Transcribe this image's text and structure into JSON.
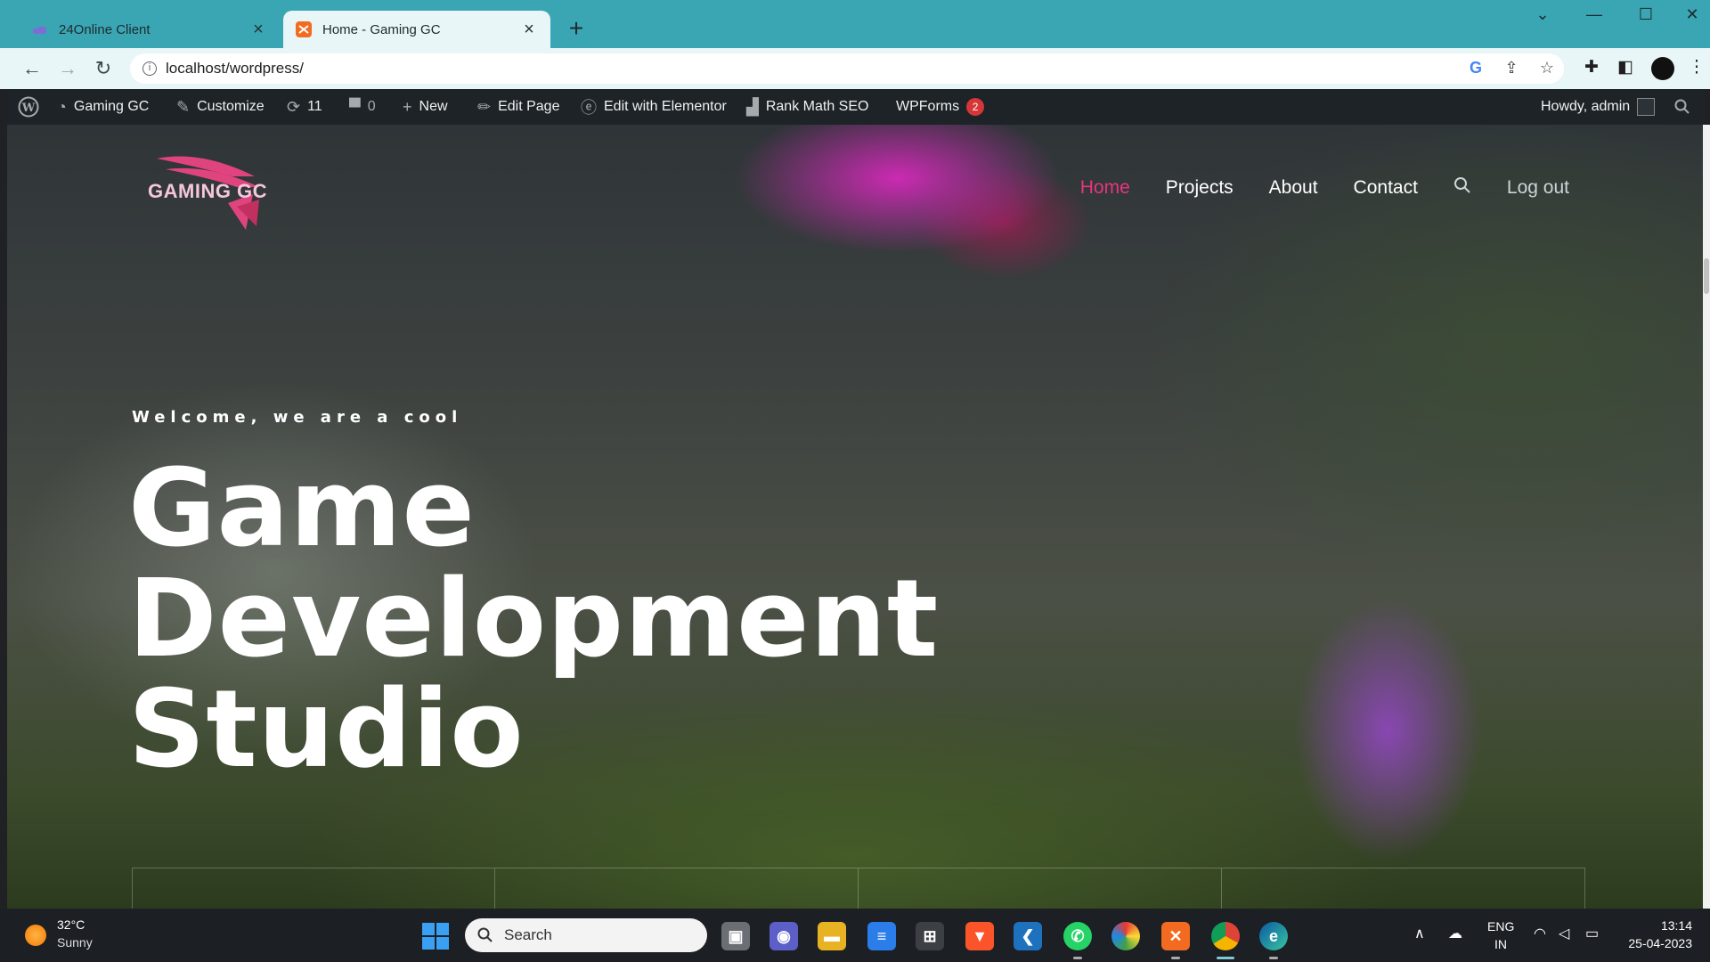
{
  "browser": {
    "tabs": [
      {
        "title": "24Online Client",
        "icon": "cloud-icon"
      },
      {
        "title": "Home - Gaming GC",
        "icon": "gaming-favicon",
        "active": true
      }
    ],
    "new_tab": "+",
    "url": "localhost/wordpress/",
    "accent": "#3aa6b3"
  },
  "admin_bar": {
    "site": "Gaming GC",
    "customize": "Customize",
    "updates": "11",
    "comments": "0",
    "new": "New",
    "edit_page": "Edit Page",
    "elementor": "Edit with Elementor",
    "rank_math": "Rank Math SEO",
    "wpforms": "WPForms",
    "wpforms_count": "2",
    "howdy": "Howdy, admin"
  },
  "site": {
    "logo_text": "GAMING GC",
    "nav": [
      "Home",
      "Projects",
      "About",
      "Contact"
    ],
    "logout": "Log out",
    "accent": "#e8357f"
  },
  "hero": {
    "subtitle": "Welcome, we are a cool",
    "title_lines": [
      "Game",
      "Development",
      "Studio"
    ]
  },
  "taskbar": {
    "temperature": "32°C",
    "condition": "Sunny",
    "search": "Search",
    "lang_top": "ENG",
    "lang_bottom": "IN",
    "time": "13:14",
    "date": "25-04-2023"
  }
}
